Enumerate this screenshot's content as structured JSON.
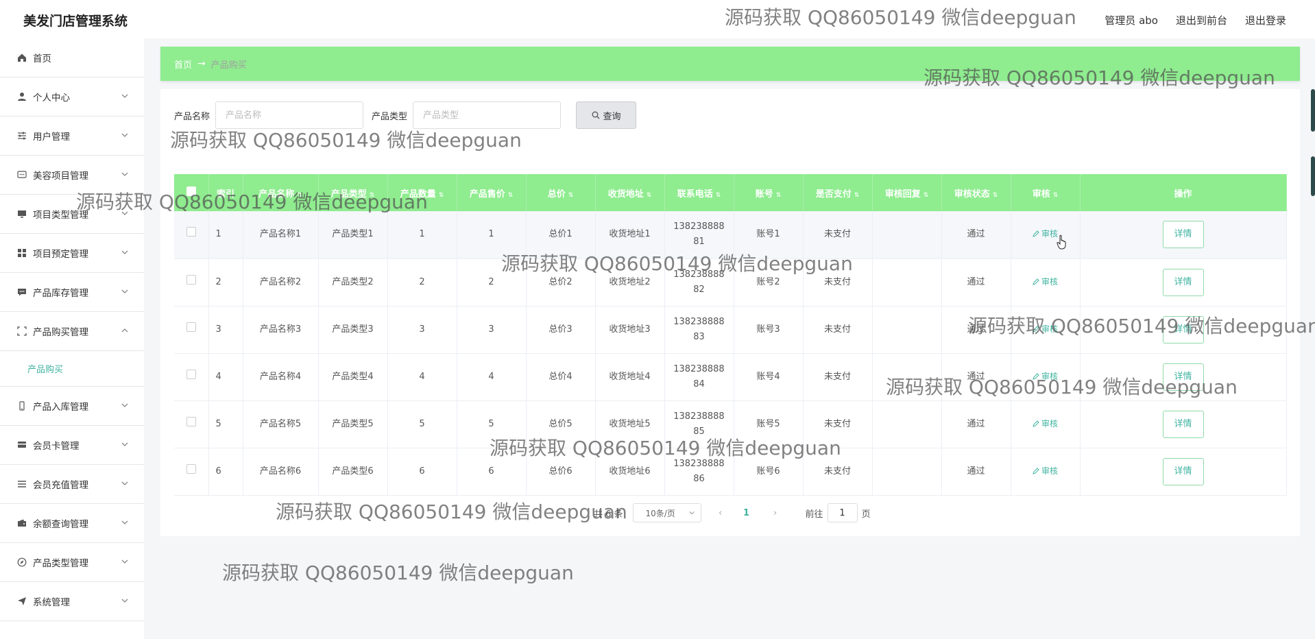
{
  "header": {
    "title": "美发门店管理系统",
    "admin": "管理员 abo",
    "to_front": "退出到前台",
    "logout": "退出登录"
  },
  "sidebar": {
    "items": [
      {
        "label": "首页",
        "icon": "home-icon"
      },
      {
        "label": "个人中心",
        "icon": "user-icon"
      },
      {
        "label": "用户管理",
        "icon": "sliders-icon"
      },
      {
        "label": "美容项目管理",
        "icon": "chat-icon"
      },
      {
        "label": "项目类型管理",
        "icon": "monitor-icon"
      },
      {
        "label": "项目预定管理",
        "icon": "grid-icon"
      },
      {
        "label": "产品库存管理",
        "icon": "message-icon"
      },
      {
        "label": "产品购买管理",
        "icon": "fullscreen-icon"
      },
      {
        "label": "产品入库管理",
        "icon": "phone-icon"
      },
      {
        "label": "会员卡管理",
        "icon": "card-icon"
      },
      {
        "label": "会员充值管理",
        "icon": "list-icon"
      },
      {
        "label": "余额查询管理",
        "icon": "wallet-icon"
      },
      {
        "label": "产品类型管理",
        "icon": "compass-icon"
      },
      {
        "label": "系统管理",
        "icon": "send-icon"
      }
    ],
    "submenu": "产品购买"
  },
  "breadcrumb": {
    "home": "首页",
    "current": "产品购买"
  },
  "search": {
    "name_label": "产品名称",
    "name_placeholder": "产品名称",
    "type_label": "产品类型",
    "type_placeholder": "产品类型",
    "button": "查询"
  },
  "table": {
    "columns": [
      "索引",
      "产品名称",
      "产品类型",
      "产品数量",
      "产品售价",
      "总价",
      "收货地址",
      "联系电话",
      "账号",
      "是否支付",
      "审核回复",
      "审核状态",
      "审核",
      "操作"
    ],
    "rows": [
      {
        "index": "1",
        "name": "产品名称1",
        "type": "产品类型1",
        "qty": "1",
        "price": "1",
        "total": "总价1",
        "address": "收货地址1",
        "phone": "13823888881",
        "account": "账号1",
        "paid": "未支付",
        "reply": "",
        "status": "通过",
        "audit": "审核",
        "action": "详情"
      },
      {
        "index": "2",
        "name": "产品名称2",
        "type": "产品类型2",
        "qty": "2",
        "price": "2",
        "total": "总价2",
        "address": "收货地址2",
        "phone": "13823888882",
        "account": "账号2",
        "paid": "未支付",
        "reply": "",
        "status": "通过",
        "audit": "审核",
        "action": "详情"
      },
      {
        "index": "3",
        "name": "产品名称3",
        "type": "产品类型3",
        "qty": "3",
        "price": "3",
        "total": "总价3",
        "address": "收货地址3",
        "phone": "13823888883",
        "account": "账号3",
        "paid": "未支付",
        "reply": "",
        "status": "通过",
        "audit": "审核",
        "action": "详情"
      },
      {
        "index": "4",
        "name": "产品名称4",
        "type": "产品类型4",
        "qty": "4",
        "price": "4",
        "total": "总价4",
        "address": "收货地址4",
        "phone": "13823888884",
        "account": "账号4",
        "paid": "未支付",
        "reply": "",
        "status": "通过",
        "audit": "审核",
        "action": "详情"
      },
      {
        "index": "5",
        "name": "产品名称5",
        "type": "产品类型5",
        "qty": "5",
        "price": "5",
        "total": "总价5",
        "address": "收货地址5",
        "phone": "13823888885",
        "account": "账号5",
        "paid": "未支付",
        "reply": "",
        "status": "通过",
        "audit": "审核",
        "action": "详情"
      },
      {
        "index": "6",
        "name": "产品名称6",
        "type": "产品类型6",
        "qty": "6",
        "price": "6",
        "total": "总价6",
        "address": "收货地址6",
        "phone": "13823888886",
        "account": "账号6",
        "paid": "未支付",
        "reply": "",
        "status": "通过",
        "audit": "审核",
        "action": "详情"
      }
    ]
  },
  "pagination": {
    "total": "共 6 条",
    "page_size": "10条/页",
    "current_page": "1",
    "goto_label": "前往",
    "goto_value": "1",
    "page_suffix": "页"
  },
  "watermark": "源码获取 QQ86050149 微信deepguan",
  "colors": {
    "accent_green": "#8fec8f",
    "link_teal": "#3fb3a0"
  }
}
